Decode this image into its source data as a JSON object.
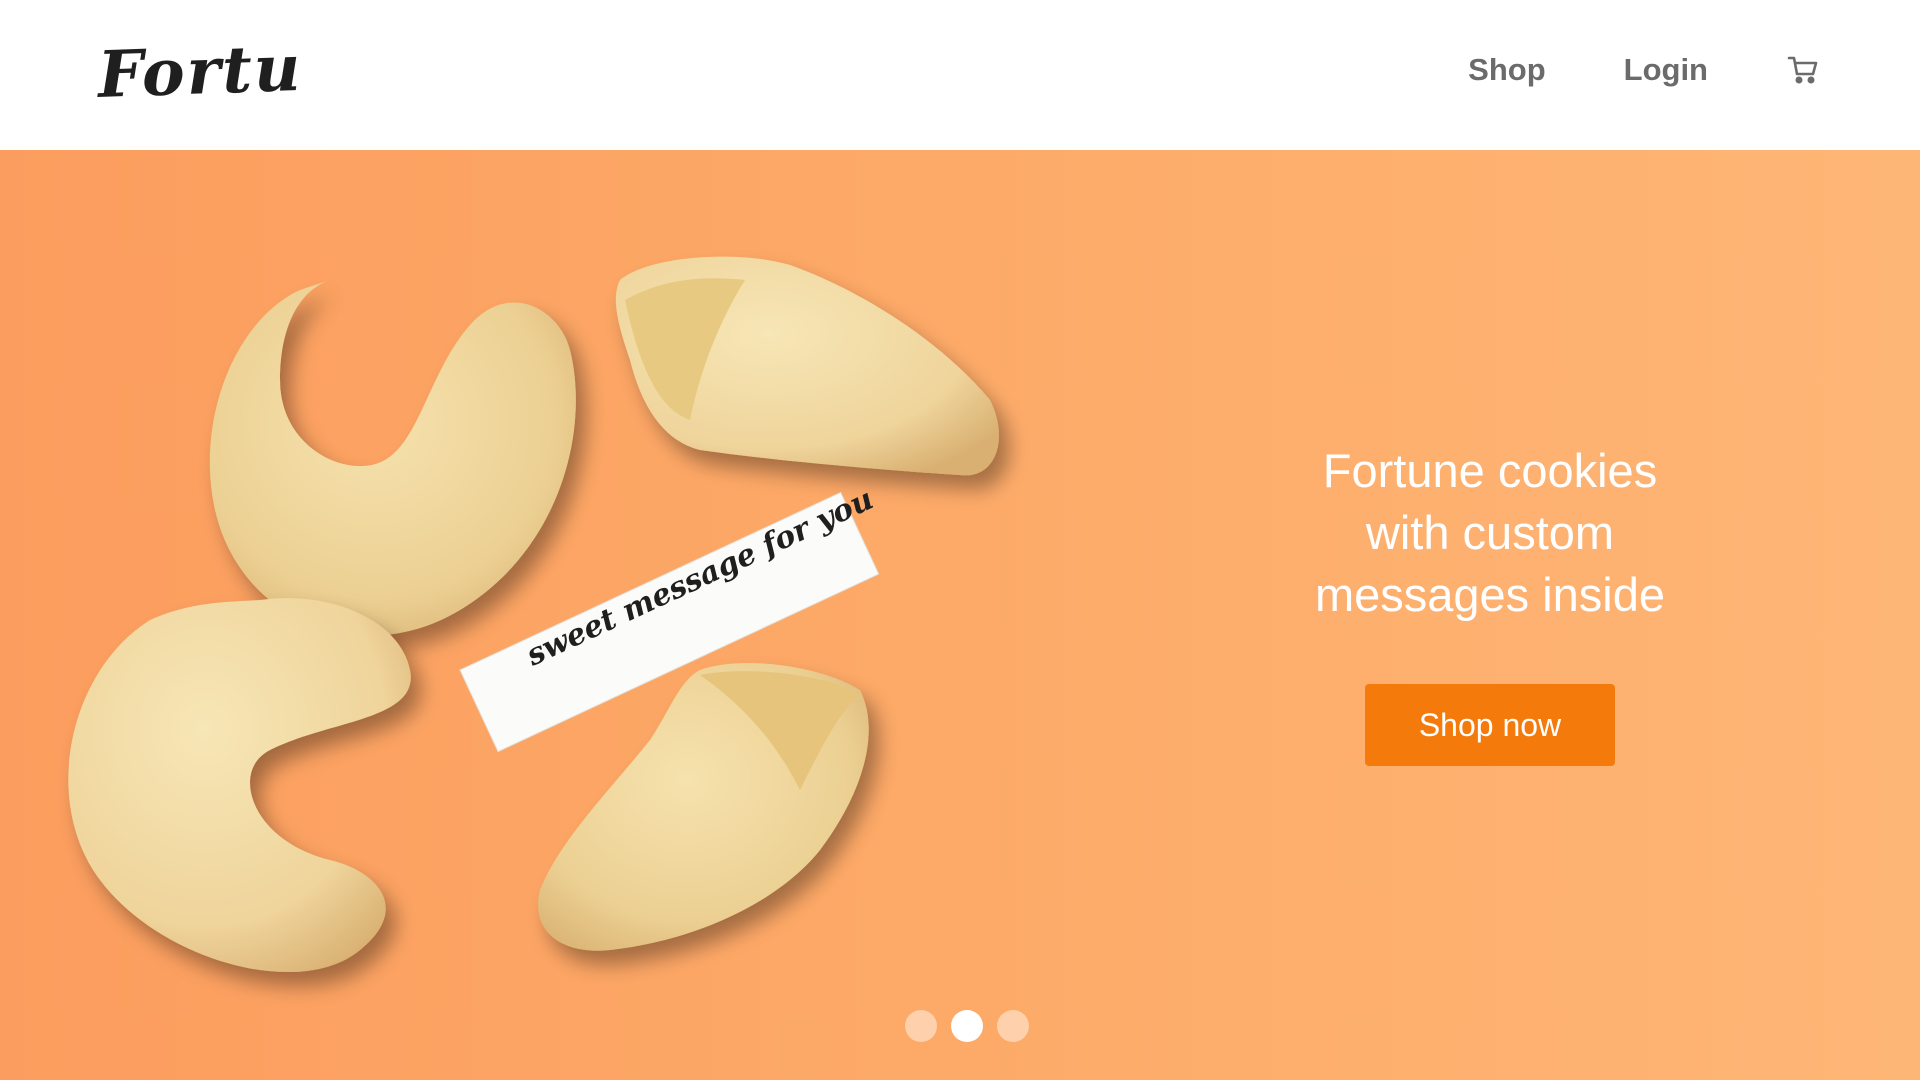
{
  "brand": {
    "logo_text": "Fortu"
  },
  "nav": {
    "items": [
      {
        "label": "Shop"
      },
      {
        "label": "Login"
      }
    ],
    "cart_icon": "shopping-cart-icon"
  },
  "hero": {
    "paper_message": "sweet message for you",
    "headline": [
      "Fortune cookies",
      "with custom",
      "messages inside"
    ],
    "cta_label": "Shop now",
    "carousel": {
      "total_slides": 3,
      "active_index": 1
    }
  },
  "colors": {
    "hero_background": "#fdb06f",
    "cta": "#f47b0b",
    "cookie": "#f1d9a0",
    "nav_text": "#6b6b6b",
    "logo": "#1f1f1f"
  }
}
